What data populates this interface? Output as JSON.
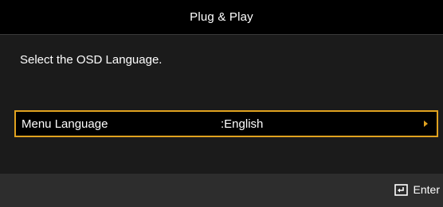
{
  "title": "Plug & Play",
  "instruction": "Select the OSD Language.",
  "menu": {
    "label": "Menu Language",
    "value": ":English"
  },
  "footer": {
    "enter_label": "Enter",
    "enter_icon": "enter-icon"
  },
  "colors": {
    "accent": "#e0a21f",
    "background": "#000000",
    "content_background": "#1b1b1b",
    "footer_background": "#2d2d2d",
    "text": "#ffffff"
  }
}
